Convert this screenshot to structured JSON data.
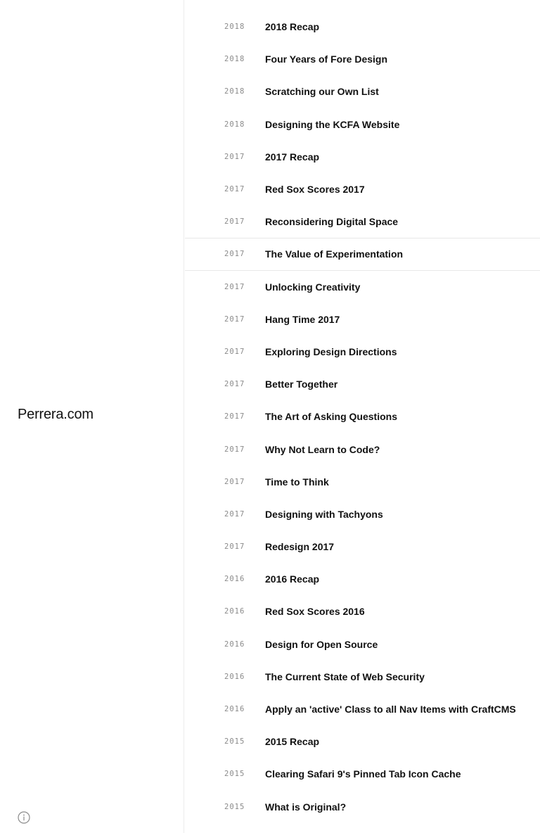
{
  "site": {
    "title": "Perrera.com"
  },
  "icons": {
    "info": "info-circle-icon"
  },
  "posts": [
    {
      "year": "2018",
      "title": "2018 Recap"
    },
    {
      "year": "2018",
      "title": "Four Years of Fore Design"
    },
    {
      "year": "2018",
      "title": "Scratching our Own List"
    },
    {
      "year": "2018",
      "title": "Designing the KCFA Website"
    },
    {
      "year": "2017",
      "title": "2017 Recap"
    },
    {
      "year": "2017",
      "title": "Red Sox Scores 2017"
    },
    {
      "year": "2017",
      "title": "Reconsidering Digital Space"
    },
    {
      "year": "2017",
      "title": "The Value of Experimentation",
      "active": true
    },
    {
      "year": "2017",
      "title": "Unlocking Creativity"
    },
    {
      "year": "2017",
      "title": "Hang Time 2017"
    },
    {
      "year": "2017",
      "title": "Exploring Design Directions"
    },
    {
      "year": "2017",
      "title": "Better Together"
    },
    {
      "year": "2017",
      "title": "The Art of Asking Questions"
    },
    {
      "year": "2017",
      "title": "Why Not Learn to Code?"
    },
    {
      "year": "2017",
      "title": "Time to Think"
    },
    {
      "year": "2017",
      "title": "Designing with Tachyons"
    },
    {
      "year": "2017",
      "title": "Redesign 2017"
    },
    {
      "year": "2016",
      "title": "2016 Recap"
    },
    {
      "year": "2016",
      "title": "Red Sox Scores 2016"
    },
    {
      "year": "2016",
      "title": "Design for Open Source"
    },
    {
      "year": "2016",
      "title": "The Current State of Web Security"
    },
    {
      "year": "2016",
      "title": "Apply an 'active' Class to all Nav Items with CraftCMS"
    },
    {
      "year": "2015",
      "title": "2015 Recap"
    },
    {
      "year": "2015",
      "title": "Clearing Safari 9's Pinned Tab Icon Cache"
    },
    {
      "year": "2015",
      "title": "What is Original?"
    }
  ]
}
